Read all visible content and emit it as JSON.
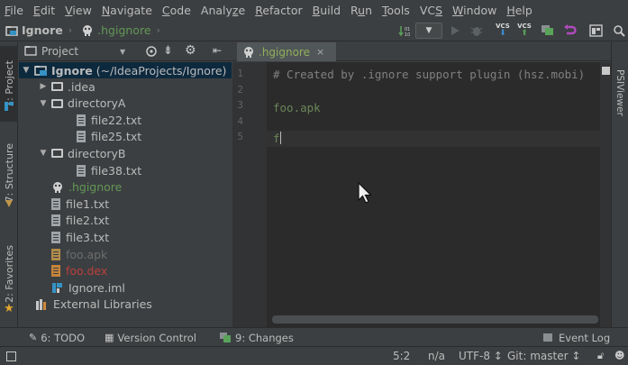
{
  "menu": [
    "File",
    "Edit",
    "View",
    "Navigate",
    "Code",
    "Analyze",
    "Refactor",
    "Build",
    "Run",
    "Tools",
    "VCS",
    "Window",
    "Help"
  ],
  "menu_mnemonic_index": [
    0,
    0,
    0,
    0,
    0,
    5,
    0,
    0,
    1,
    0,
    2,
    0,
    0
  ],
  "navbar": {
    "project": "Ignore",
    "file": ".hgignore",
    "toolbar_badges": {
      "vcs_update": "VCS",
      "vcs_commit": "VCS"
    }
  },
  "left_stripe": {
    "project_tab": "1: Project",
    "structure_tab": "7: Structure",
    "favorites_tab": "2: Favorites"
  },
  "project_panel": {
    "title": "Project",
    "root": {
      "name": "Ignore",
      "path": "(~/IdeaProjects/Ignore)"
    },
    "items": [
      {
        "label": ".idea",
        "kind": "folder",
        "color": "#bbbbbb"
      },
      {
        "label": "directoryA",
        "kind": "folder",
        "color": "#bbbbbb"
      },
      {
        "label": "file22.txt",
        "kind": "file",
        "color": "#bbbbbb"
      },
      {
        "label": "file25.txt",
        "kind": "file",
        "color": "#bbbbbb"
      },
      {
        "label": "directoryB",
        "kind": "folder",
        "color": "#bbbbbb"
      },
      {
        "label": "file38.txt",
        "kind": "file",
        "color": "#bbbbbb"
      },
      {
        "label": ".hgignore",
        "kind": "ignore",
        "color": "#629755"
      },
      {
        "label": "file1.txt",
        "kind": "file",
        "color": "#bbbbbb"
      },
      {
        "label": "file2.txt",
        "kind": "file",
        "color": "#bbbbbb"
      },
      {
        "label": "file3.txt",
        "kind": "file",
        "color": "#bbbbbb"
      },
      {
        "label": "foo.apk",
        "kind": "file-ignored",
        "color": "#6c6c6c"
      },
      {
        "label": "foo.dex",
        "kind": "file-ignored",
        "color": "#bc3f3c"
      },
      {
        "label": "Ignore.iml",
        "kind": "module",
        "color": "#bbbbbb"
      },
      {
        "label": "External Libraries",
        "kind": "libraries",
        "color": "#bbbbbb"
      }
    ]
  },
  "editor": {
    "tab": ".hgignore",
    "lines": [
      "# Created by .ignore support plugin (hsz.mobi)",
      "",
      "foo.apk",
      "",
      "f"
    ],
    "line_numbers": [
      "1",
      "2",
      "3",
      "4",
      "5"
    ]
  },
  "right_stripe": {
    "label": "PSIViewer"
  },
  "bottom_tabs": {
    "todo": "6: TODO",
    "version_control": "Version Control",
    "changes": "9: Changes",
    "event_log": "Event Log"
  },
  "status": {
    "position": "5:2",
    "na": "n/a",
    "encoding": "UTF-8 ↕",
    "git": "Git: master ↕"
  },
  "colors": {
    "background": "#3c3f41",
    "editor_bg": "#2b2b2b",
    "selection": "#0d293e",
    "comment": "#808080",
    "ignored_entry": "#6a8759",
    "hgignore_file": "#629755",
    "foo_dex": "#bc3f3c"
  }
}
